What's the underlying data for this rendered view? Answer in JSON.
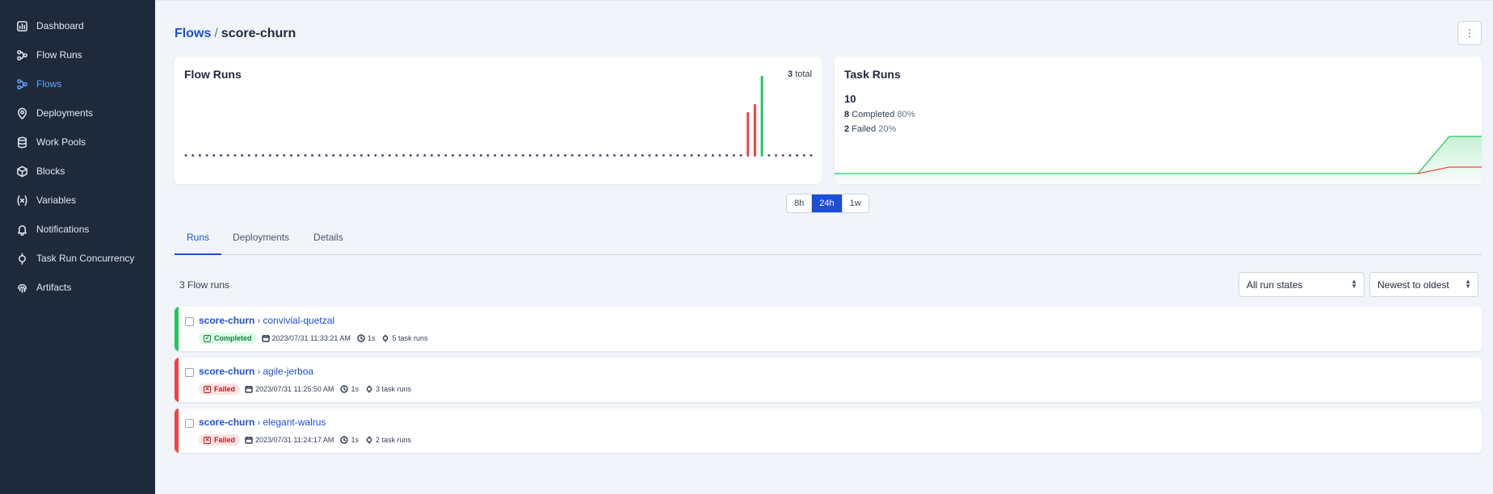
{
  "sidebar": {
    "items": [
      {
        "label": "Dashboard",
        "icon": "chart-icon"
      },
      {
        "label": "Flow Runs",
        "icon": "flow-runs-icon"
      },
      {
        "label": "Flows",
        "icon": "flows-icon",
        "active": true
      },
      {
        "label": "Deployments",
        "icon": "map-pin-icon"
      },
      {
        "label": "Work Pools",
        "icon": "database-icon"
      },
      {
        "label": "Blocks",
        "icon": "cube-icon"
      },
      {
        "label": "Variables",
        "icon": "variable-icon"
      },
      {
        "label": "Notifications",
        "icon": "bell-icon"
      },
      {
        "label": "Task Run Concurrency",
        "icon": "concurrency-icon"
      },
      {
        "label": "Artifacts",
        "icon": "fingerprint-icon"
      }
    ]
  },
  "header": {
    "breadcrumb_root": "Flows",
    "separator": "/",
    "breadcrumb_current": "score-churn",
    "menu_icon": "⋮"
  },
  "flow_runs_card": {
    "title": "Flow Runs",
    "total_count": "3",
    "total_label": "total"
  },
  "task_runs_card": {
    "title": "Task Runs",
    "total": "10",
    "completed_count": "8",
    "completed_label": "Completed",
    "completed_pct": "80%",
    "failed_count": "2",
    "failed_label": "Failed",
    "failed_pct": "20%"
  },
  "time_range": {
    "options": [
      "8h",
      "24h",
      "1w"
    ],
    "selected": "24h"
  },
  "tabs": [
    "Runs",
    "Deployments",
    "Details"
  ],
  "runs_section": {
    "count_label": "3 Flow runs",
    "state_filter": "All run states",
    "sort": "Newest to oldest"
  },
  "runs": [
    {
      "flow": "score-churn",
      "name": "convivial-quetzal",
      "state": "Completed",
      "timestamp": "2023/07/31 11:33:21 AM",
      "duration": "1s",
      "task_runs": "5 task runs"
    },
    {
      "flow": "score-churn",
      "name": "agile-jerboa",
      "state": "Failed",
      "timestamp": "2023/07/31 11:25:50 AM",
      "duration": "1s",
      "task_runs": "3 task runs"
    },
    {
      "flow": "score-churn",
      "name": "elegant-walrus",
      "state": "Failed",
      "timestamp": "2023/07/31 11:24:17 AM",
      "duration": "1s",
      "task_runs": "2 task runs"
    }
  ],
  "colors": {
    "completed": "#22c55e",
    "failed": "#ef4444",
    "accent": "#1d4ed8",
    "sidebar_bg": "#1e293b",
    "empty_dot": "#475569"
  }
}
